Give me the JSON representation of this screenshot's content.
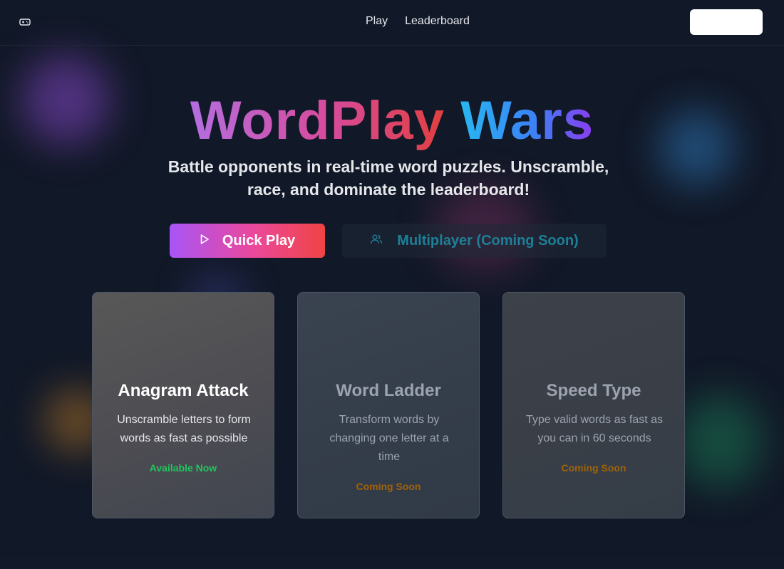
{
  "nav": {
    "logo_icon": "gamepad-icon",
    "links": [
      "Play",
      "Leaderboard"
    ],
    "action_button_label": ""
  },
  "hero": {
    "title_part1": "WordPlay",
    "title_part2": "Wars",
    "subtitle": "Battle opponents in real-time word puzzles. Unscramble, race, and dominate the leaderboard!",
    "primary_button": {
      "label": "Quick Play",
      "icon": "play-icon"
    },
    "secondary_button": {
      "label": "Multiplayer (Coming Soon)",
      "icon": "users-icon"
    }
  },
  "games": [
    {
      "title": "Anagram Attack",
      "description": "Unscramble letters to form words as fast as possible",
      "status": "Available Now"
    },
    {
      "title": "Word Ladder",
      "description": "Transform words by changing one letter at a time",
      "status": "Coming Soon"
    },
    {
      "title": "Speed Type",
      "description": "Type valid words as fast as you can in 60 seconds",
      "status": "Coming Soon"
    }
  ],
  "colors": {
    "background": "#111827",
    "available": "#22c55e",
    "coming_soon": "#a16207",
    "multiplayer_text": "#1e7f96"
  }
}
